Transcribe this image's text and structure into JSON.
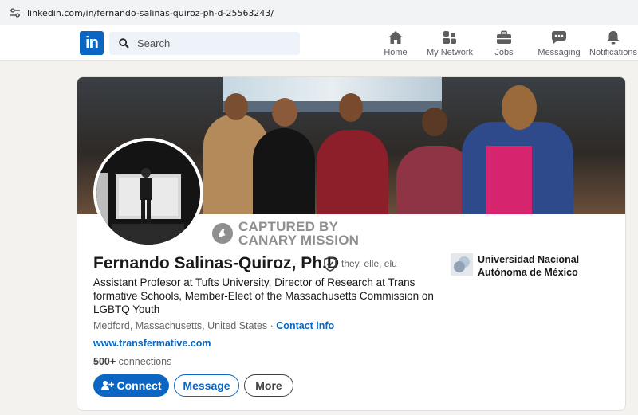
{
  "browser": {
    "url": "linkedin.com/in/fernando-salinas-quiroz-ph-d-25563243/"
  },
  "nav": {
    "logo_text": "in",
    "search_placeholder": "Search",
    "items": [
      {
        "label": "Home",
        "icon": "home-icon"
      },
      {
        "label": "My Network",
        "icon": "network-icon"
      },
      {
        "label": "Jobs",
        "icon": "briefcase-icon"
      },
      {
        "label": "Messaging",
        "icon": "chat-icon"
      },
      {
        "label": "Notifications",
        "icon": "bell-icon"
      }
    ]
  },
  "profile": {
    "watermark_line1": "CAPTURED BY",
    "watermark_line2": "CANARY MISSION",
    "name": "Fernando Salinas-Quiroz, Ph.D",
    "pronouns": "they, elle, elu",
    "headline": "Assistant Profesor at Tufts University, Director of Research at Trans formative Schools, Member-Elect of the Massachusetts Commission on LGBTQ Youth",
    "location": "Medford, Massachusetts, United States",
    "separator": " · ",
    "contact_info": "Contact info",
    "website": "www.transfermative.com",
    "connections_count": "500+",
    "connections_label": " connections",
    "education": "Universidad Nacional Autónoma de México"
  },
  "actions": {
    "connect": "Connect",
    "message": "Message",
    "more": "More"
  },
  "colors": {
    "brand": "#0a66c2",
    "background": "#f4f2ee"
  }
}
